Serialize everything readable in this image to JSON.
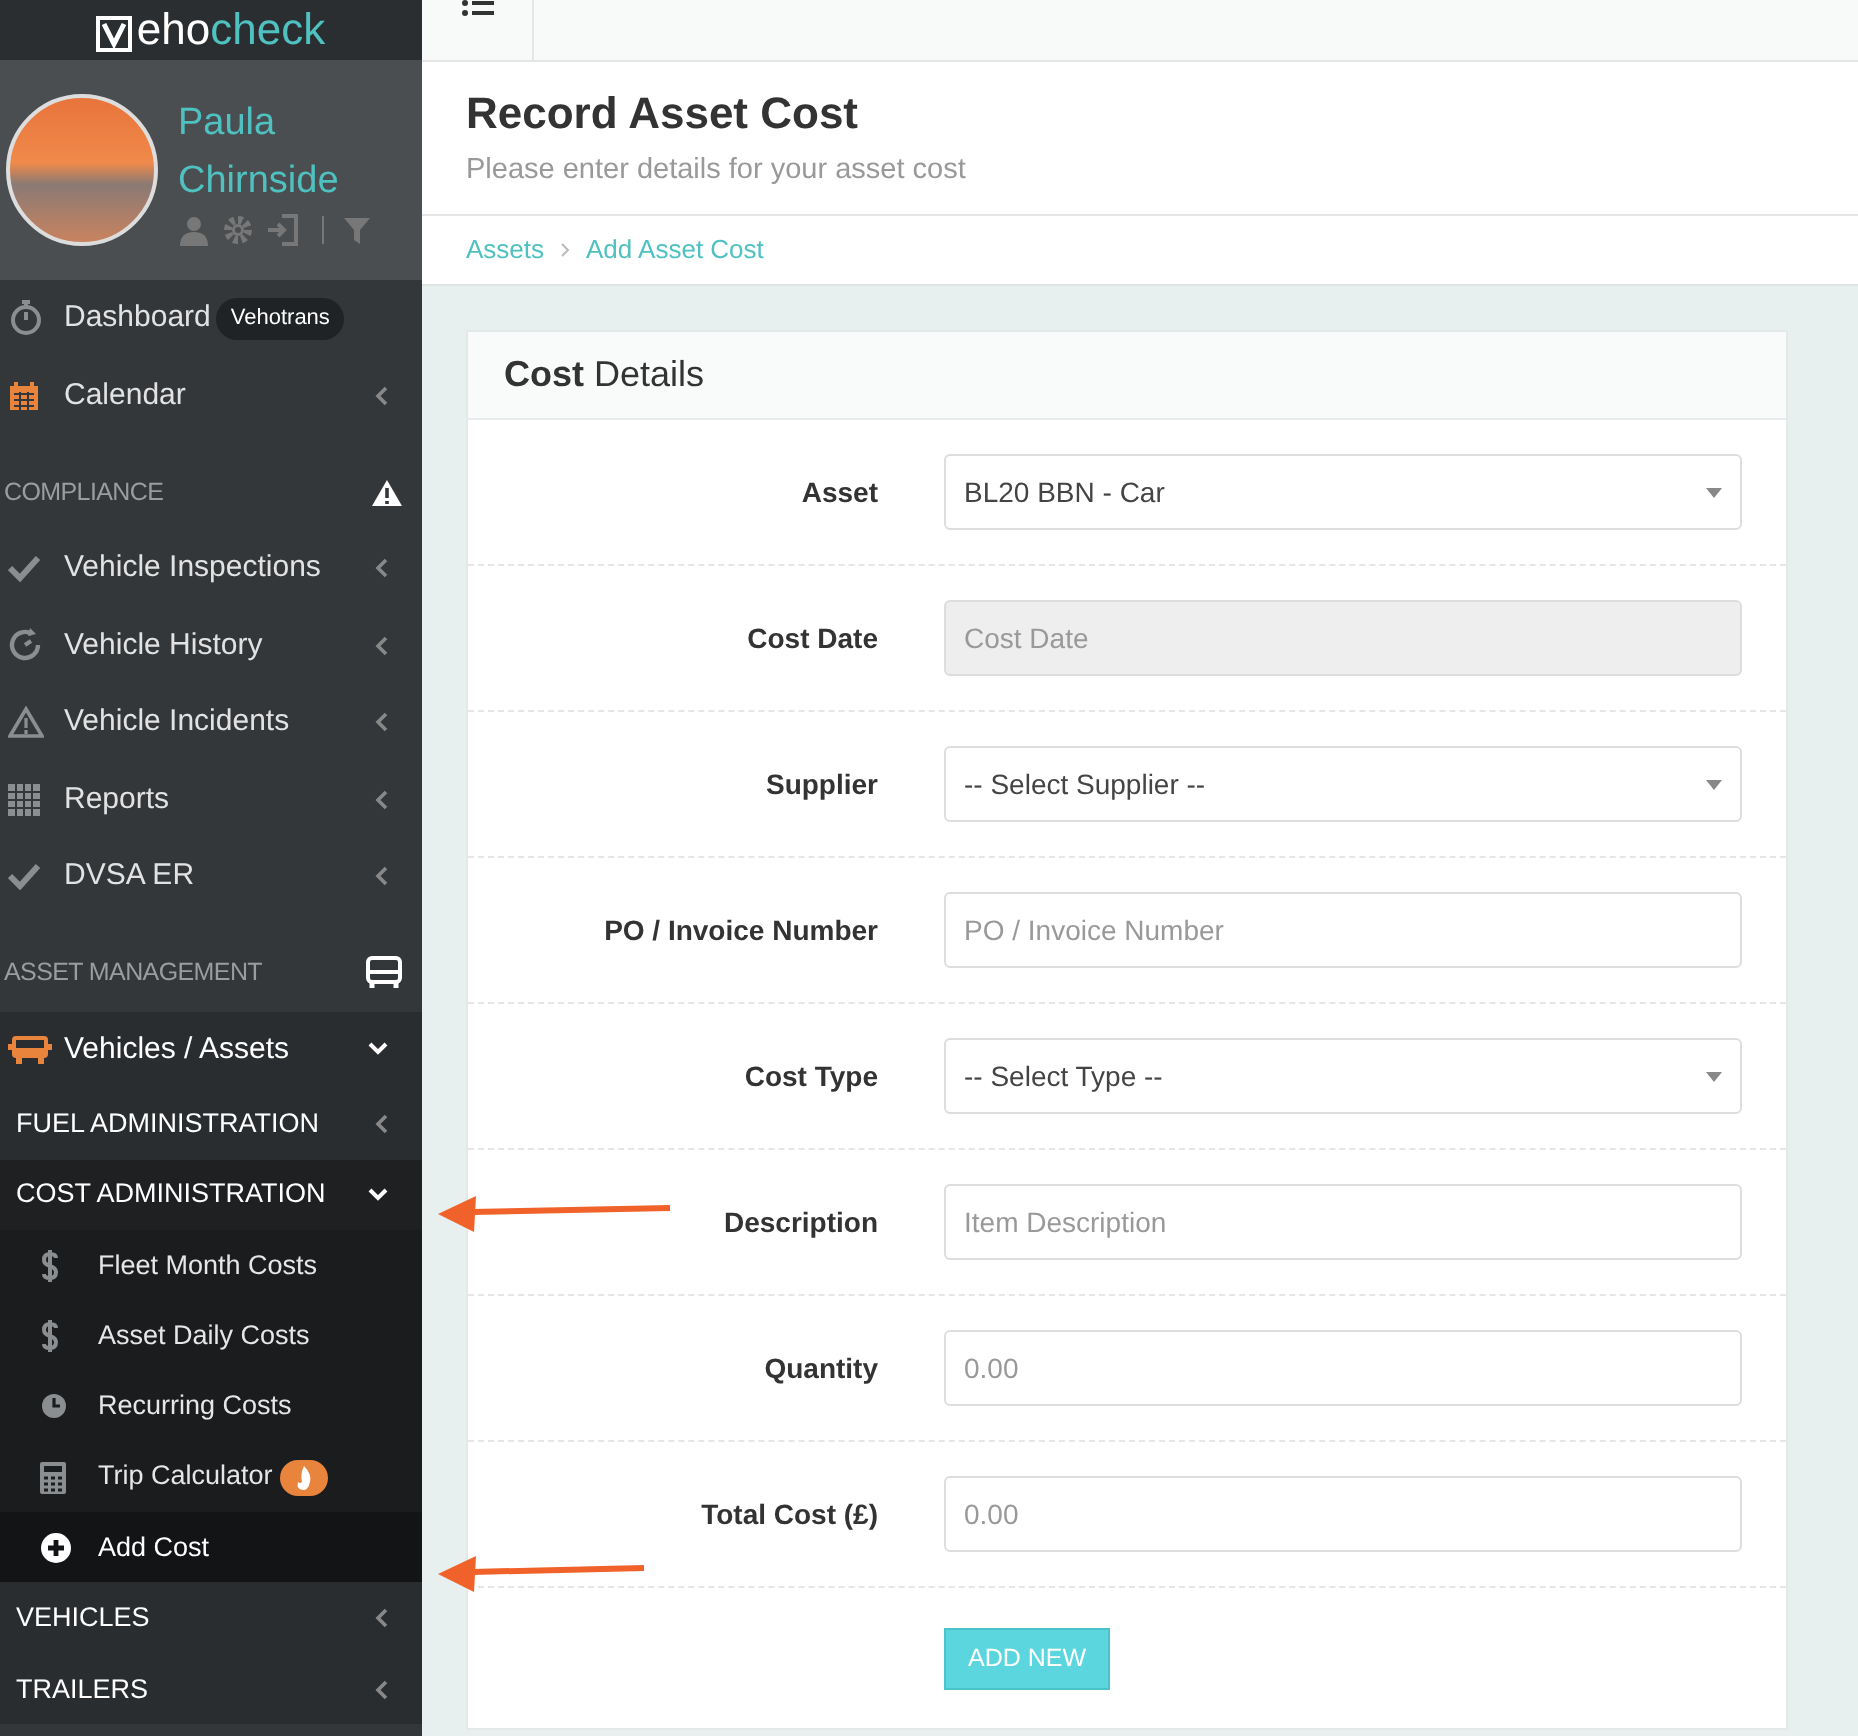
{
  "logo": {
    "text_light": "eho",
    "text_accent": "check"
  },
  "user": {
    "first_name": "Paula",
    "last_name": "Chirnside"
  },
  "sidebar": {
    "nav": [
      {
        "kind": "item",
        "label": "Dashboard",
        "badge": "Vehotrans",
        "selected": false
      },
      {
        "kind": "item",
        "label": "Calendar",
        "expanded": false,
        "selected": false
      },
      {
        "kind": "section",
        "label": "COMPLIANCE"
      },
      {
        "kind": "item",
        "label": "Vehicle Inspections",
        "expanded": false,
        "selected": false
      },
      {
        "kind": "item",
        "label": "Vehicle History",
        "expanded": false,
        "selected": false
      },
      {
        "kind": "item",
        "label": "Vehicle Incidents",
        "expanded": false,
        "selected": false
      },
      {
        "kind": "item",
        "label": "Reports",
        "expanded": false,
        "selected": false
      },
      {
        "kind": "item",
        "label": "DVSA ER",
        "expanded": false,
        "selected": false
      },
      {
        "kind": "section",
        "label": "ASSET MANAGEMENT"
      },
      {
        "kind": "item",
        "label": "Vehicles / Assets",
        "expanded": true,
        "selected": true
      },
      {
        "kind": "group",
        "label": "FUEL ADMINISTRATION",
        "expanded": false,
        "selected": false
      },
      {
        "kind": "group",
        "label": "COST ADMINISTRATION",
        "expanded": true,
        "selected": true
      },
      {
        "kind": "subitem",
        "label": "Fleet Month Costs",
        "hot": false,
        "selected": false
      },
      {
        "kind": "subitem",
        "label": "Asset Daily Costs",
        "hot": false,
        "selected": false
      },
      {
        "kind": "subitem",
        "label": "Recurring Costs",
        "hot": false,
        "selected": false
      },
      {
        "kind": "subitem",
        "label": "Trip Calculator",
        "hot": true,
        "selected": false
      },
      {
        "kind": "subitem",
        "label": "Add Cost",
        "hot": false,
        "selected": true
      },
      {
        "kind": "group",
        "label": "VEHICLES",
        "expanded": false,
        "selected": false
      },
      {
        "kind": "group",
        "label": "TRAILERS",
        "expanded": false,
        "selected": false
      }
    ]
  },
  "page": {
    "title": "Record Asset Cost",
    "subtitle": "Please enter details for your asset cost"
  },
  "breadcrumb": [
    "Assets",
    "Add Asset Cost"
  ],
  "card": {
    "title": "**Cost** Details",
    "fields": [
      {
        "label": "Asset",
        "kind": "select",
        "value": "BL20 BBN - Car"
      },
      {
        "label": "Cost Date",
        "kind": "input",
        "placeholder": "Cost Date",
        "disabled": true
      },
      {
        "label": "Supplier",
        "kind": "select",
        "value": "-- Select Supplier --"
      },
      {
        "label": "PO / Invoice Number",
        "kind": "input",
        "placeholder": "PO / Invoice Number",
        "disabled": false
      },
      {
        "label": "Cost Type",
        "kind": "select",
        "value": "-- Select Type --"
      },
      {
        "label": "Description",
        "kind": "input",
        "placeholder": "Item Description",
        "disabled": false
      },
      {
        "label": "Quantity",
        "kind": "input",
        "placeholder": "0.00",
        "disabled": false
      },
      {
        "label": "Total Cost (£)",
        "kind": "input",
        "placeholder": "0.00",
        "disabled": false
      }
    ],
    "button": "ADD NEW"
  }
}
